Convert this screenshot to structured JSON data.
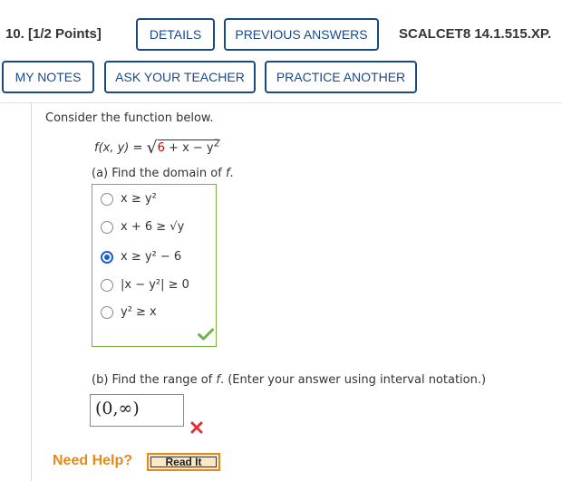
{
  "header": {
    "question_number": "10.",
    "points": "[1/2 Points]",
    "details_label": "DETAILS",
    "previous_answers_label": "PREVIOUS ANSWERS",
    "assignment_code": "SCALCET8 14.1.515.XP."
  },
  "toolbar": {
    "my_notes_label": "MY NOTES",
    "ask_teacher_label": "ASK YOUR TEACHER",
    "practice_another_label": "PRACTICE ANOTHER"
  },
  "question": {
    "intro": "Consider the function below.",
    "function_lhs": "f(x, y) = ",
    "function_radicand_red": "6",
    "function_radicand_rest": " + x − y",
    "function_exponent": "2",
    "part_a_prompt_prefix": "(a) Find the domain of ",
    "part_a_prompt_var": "f",
    "part_a_prompt_suffix": ".",
    "choices": [
      {
        "text": "x ≥ y²",
        "selected": false
      },
      {
        "text": "x + 6 ≥ √y",
        "selected": false
      },
      {
        "text": "x ≥ y² − 6",
        "selected": true
      },
      {
        "text": "|x − y²| ≥ 0",
        "selected": false
      },
      {
        "text": "y² ≥ x",
        "selected": false
      }
    ],
    "part_a_status": "correct",
    "part_b_prompt_prefix": "(b) Find the range of ",
    "part_b_prompt_var": "f",
    "part_b_prompt_suffix": ". (Enter your answer using interval notation.)",
    "part_b_answer": "(0,∞)",
    "part_b_status": "incorrect"
  },
  "help": {
    "need_help_label": "Need Help?",
    "read_it_label": "Read It"
  },
  "colors": {
    "button_border": "#1a4a86",
    "correct_green": "#6bb34a",
    "incorrect_red": "#e03434",
    "help_orange": "#e48a1c"
  },
  "icons": {
    "correct": "check-mark-icon",
    "incorrect": "x-mark-icon"
  }
}
